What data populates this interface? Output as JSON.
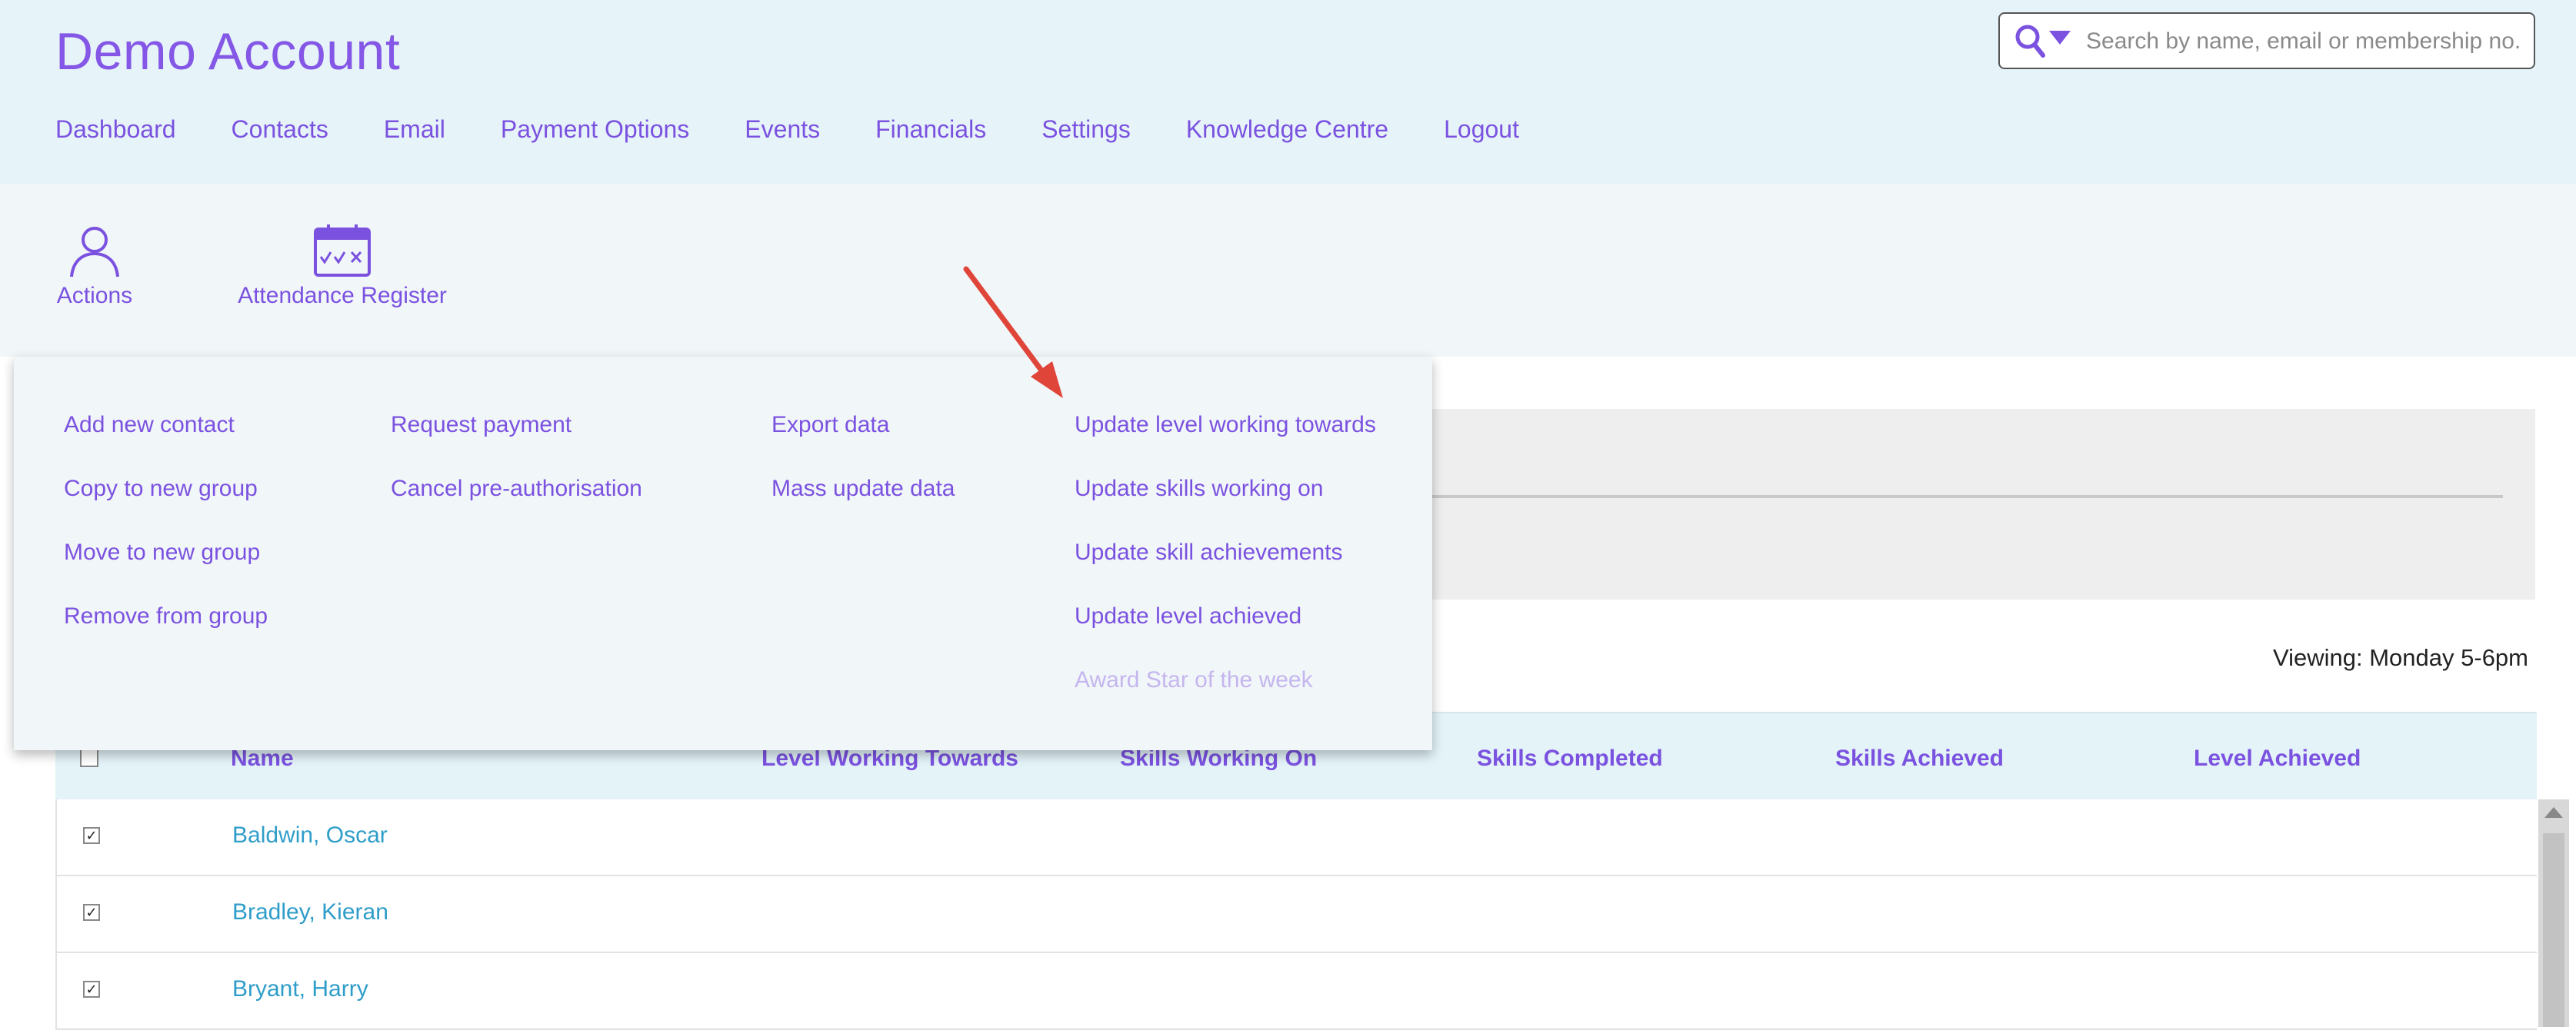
{
  "header": {
    "brand": "Demo Account",
    "nav": [
      "Dashboard",
      "Contacts",
      "Email",
      "Payment Options",
      "Events",
      "Financials",
      "Settings",
      "Knowledge Centre",
      "Logout"
    ],
    "search": {
      "placeholder": "Search by name, email or membership no.",
      "value": ""
    }
  },
  "toolbar": {
    "actions_label": "Actions",
    "register_label": "Attendance Register"
  },
  "actions_menu": {
    "col1": [
      "Add new contact",
      "Copy to new group",
      "Move to new group",
      "Remove from group"
    ],
    "col2": [
      "Request payment",
      "Cancel pre-authorisation"
    ],
    "col3": [
      "Export data",
      "Mass update data"
    ],
    "col4": [
      "Update level working towards",
      "Update skills working on",
      "Update skill achievements",
      "Update level achieved"
    ],
    "col4_disabled": "Award Star of the week"
  },
  "viewing": "Viewing: Monday 5-6pm",
  "table": {
    "columns": [
      "Name",
      "Level Working Towards",
      "Skills Working On",
      "Skills Completed",
      "Skills Achieved",
      "Level Achieved"
    ],
    "rows": [
      {
        "name": "Baldwin, Oscar",
        "checked": true
      },
      {
        "name": "Bradley, Kieran",
        "checked": true
      },
      {
        "name": "Bryant, Harry",
        "checked": true
      }
    ]
  },
  "colors": {
    "accent": "#7b52e0",
    "link": "#2f9dc9",
    "header_bg": "#e6f4f9",
    "annotation_arrow": "#e0453a"
  }
}
